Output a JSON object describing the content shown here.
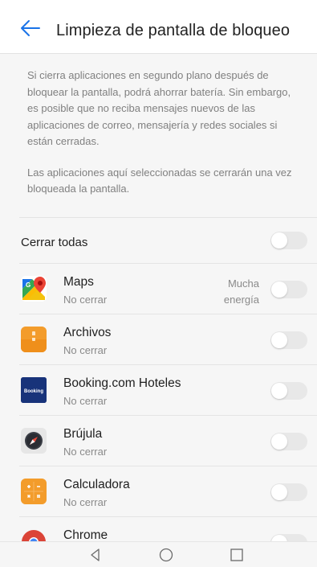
{
  "header": {
    "title": "Limpieza de pantalla de bloqueo"
  },
  "description": {
    "paragraph1": "Si cierra aplicaciones en segundo plano después de bloquear la pantalla, podrá ahorrar batería. Sin embargo, es posible que no reciba mensajes nuevos de las aplicaciones de correo, mensajería y redes sociales si están cerradas.",
    "paragraph2": "Las aplicaciones aquí seleccionadas se cerrarán una vez bloqueada la pantalla."
  },
  "close_all": {
    "label": "Cerrar todas",
    "on": false
  },
  "apps": [
    {
      "name": "Maps",
      "status": "No cerrar",
      "note": "Mucha energía",
      "icon": "google-maps-icon",
      "on": false
    },
    {
      "name": "Archivos",
      "status": "No cerrar",
      "note": "",
      "icon": "files-icon",
      "on": false
    },
    {
      "name": "Booking.com Hoteles",
      "status": "No cerrar",
      "note": "",
      "icon": "booking-icon",
      "icon_text": "Booking",
      "on": false
    },
    {
      "name": "Brújula",
      "status": "No cerrar",
      "note": "",
      "icon": "compass-icon",
      "on": false
    },
    {
      "name": "Calculadora",
      "status": "No cerrar",
      "note": "",
      "icon": "calculator-icon",
      "on": false
    },
    {
      "name": "Chrome",
      "status": "",
      "note": "",
      "icon": "chrome-icon",
      "on": false
    }
  ],
  "colors": {
    "accent": "#1a73e8",
    "toggle_off": "#e8e8e8",
    "background": "#f6f6f6"
  }
}
